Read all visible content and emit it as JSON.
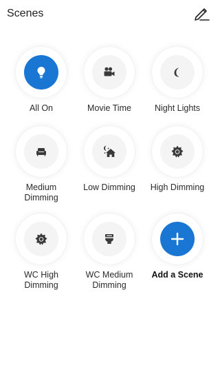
{
  "header": {
    "title": "Scenes",
    "edit_icon": "edit-pencil-icon"
  },
  "colors": {
    "accent": "#1976d2",
    "icon_dark": "#3a3a3a",
    "tile_inner": "#f4f4f4"
  },
  "scenes": [
    {
      "label": "All On",
      "icon": "lightbulb-icon",
      "active": true
    },
    {
      "label": "Movie Time",
      "icon": "camera-icon",
      "active": false
    },
    {
      "label": "Night Lights",
      "icon": "moon-icon",
      "active": false
    },
    {
      "label": "Medium Dimming",
      "icon": "couch-icon",
      "active": false
    },
    {
      "label": "Low Dimming",
      "icon": "house-night-icon",
      "active": false
    },
    {
      "label": "High Dimming",
      "icon": "sun-icon",
      "active": false
    },
    {
      "label": "WC High Dimming",
      "icon": "sun-icon",
      "active": false
    },
    {
      "label": "WC Medium Dimming",
      "icon": "toilet-icon",
      "active": false
    }
  ],
  "add_scene": {
    "label": "Add a Scene",
    "icon": "plus-icon"
  }
}
